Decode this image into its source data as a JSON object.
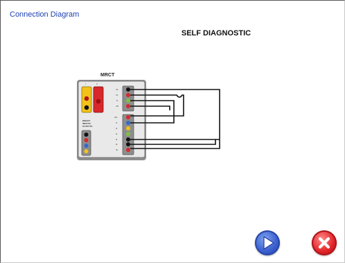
{
  "header": {
    "title": "Connection Diagram"
  },
  "main": {
    "heading": "SELF DIAGNOSTIC",
    "device_name": "MRCT",
    "panel_labels": {
      "slot_a": "I",
      "slot_b": "II",
      "binary_io": "BINARY INPUTS/ OUTPUTS",
      "terminals": [
        "V1",
        "V2",
        "N",
        "VN",
        "I1N",
        "I1",
        "I2",
        "I3",
        "I4",
        "I5",
        "IN"
      ]
    }
  },
  "footer": {
    "next_icon": "play-arrow-icon",
    "close_icon": "close-x-icon"
  },
  "colors": {
    "title_blue": "#1c3fb0",
    "next_button": "#3a5fcf",
    "close_button": "#e2252a",
    "yellow_jack": "#f2c21a",
    "red_jack": "#d8282b"
  }
}
